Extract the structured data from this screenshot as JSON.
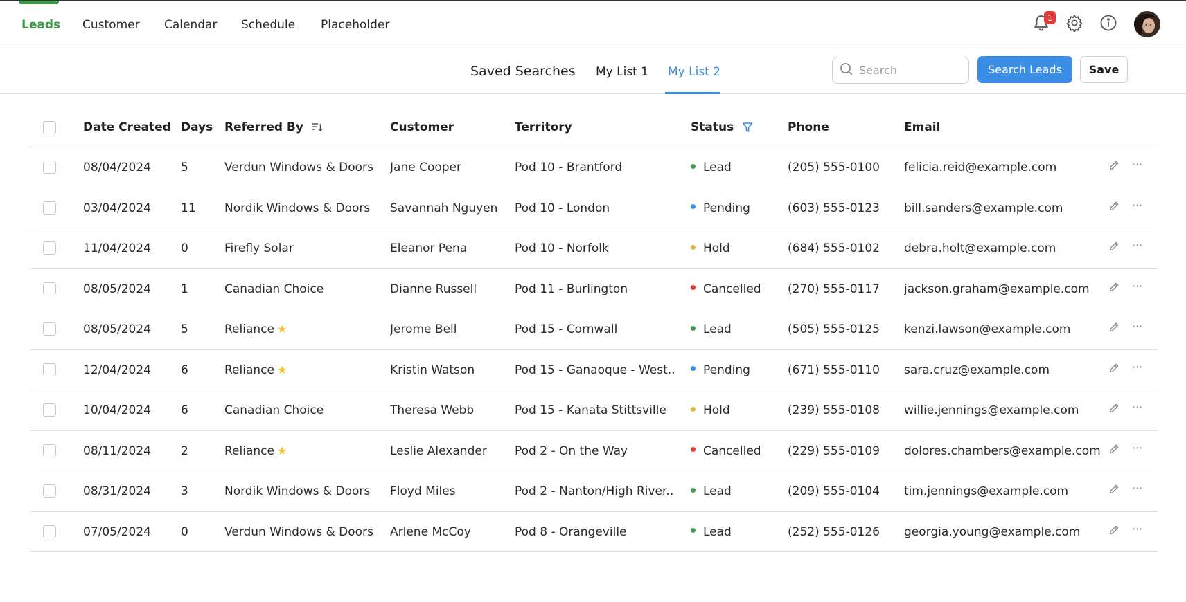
{
  "nav": {
    "items": [
      "Leads",
      "Customer",
      "Calendar",
      "Schedule",
      "Placeholder"
    ],
    "notification_count": "1",
    "accent_color": "#3f9a4b"
  },
  "subheader": {
    "title": "Saved Searches",
    "tabs": [
      "My List 1",
      "My List 2"
    ],
    "active_tab": "My List 2",
    "search_placeholder": "Search",
    "search_button": "Search Leads",
    "save_button": "Save",
    "primary_color": "#3b8ee5"
  },
  "table": {
    "headers": {
      "date": "Date Created",
      "days": "Days",
      "referred": "Referred By",
      "customer": "Customer",
      "territory": "Territory",
      "status": "Status",
      "phone": "Phone",
      "email": "Email"
    },
    "status_colors": {
      "Lead": "#3f9a4b",
      "Pending": "#3b8ee5",
      "Hold": "#e0b43a",
      "Cancelled": "#e53935"
    },
    "rows": [
      {
        "date": "08/04/2024",
        "days": "5",
        "referred": "Verdun Windows & Doors",
        "star": false,
        "customer": "Jane Cooper",
        "territory": "Pod 10 - Brantford",
        "status": "Lead",
        "phone": "(205) 555-0100",
        "email": "felicia.reid@example.com"
      },
      {
        "date": "03/04/2024",
        "days": "11",
        "referred": "Nordik Windows & Doors",
        "star": false,
        "customer": "Savannah Nguyen",
        "territory": "Pod 10 - London",
        "status": "Pending",
        "phone": "(603) 555-0123",
        "email": "bill.sanders@example.com"
      },
      {
        "date": "11/04/2024",
        "days": "0",
        "referred": "Firefly Solar",
        "star": false,
        "customer": "Eleanor Pena",
        "territory": "Pod 10 - Norfolk",
        "status": "Hold",
        "phone": "(684) 555-0102",
        "email": "debra.holt@example.com"
      },
      {
        "date": "08/05/2024",
        "days": "1",
        "referred": "Canadian Choice",
        "star": false,
        "customer": "Dianne Russell",
        "territory": "Pod 11 - Burlington",
        "status": "Cancelled",
        "phone": "(270) 555-0117",
        "email": "jackson.graham@example.com"
      },
      {
        "date": "08/05/2024",
        "days": "5",
        "referred": "Reliance",
        "star": true,
        "customer": "Jerome Bell",
        "territory": "Pod 15 - Cornwall",
        "status": "Lead",
        "phone": "(505) 555-0125",
        "email": "kenzi.lawson@example.com"
      },
      {
        "date": "12/04/2024",
        "days": "6",
        "referred": "Reliance",
        "star": true,
        "customer": "Kristin Watson",
        "territory": "Pod 15 - Ganaoque - West..",
        "status": "Pending",
        "phone": "(671) 555-0110",
        "email": "sara.cruz@example.com"
      },
      {
        "date": "10/04/2024",
        "days": "6",
        "referred": "Canadian Choice",
        "star": false,
        "customer": "Theresa Webb",
        "territory": "Pod 15 - Kanata Stittsville",
        "status": "Hold",
        "phone": "(239) 555-0108",
        "email": "willie.jennings@example.com"
      },
      {
        "date": "08/11/2024",
        "days": "2",
        "referred": "Reliance",
        "star": true,
        "customer": "Leslie Alexander",
        "territory": "Pod 2 - On the Way",
        "status": "Cancelled",
        "phone": "(229) 555-0109",
        "email": "dolores.chambers@example.com"
      },
      {
        "date": "08/31/2024",
        "days": "3",
        "referred": "Nordik Windows & Doors",
        "star": false,
        "customer": "Floyd Miles",
        "territory": "Pod 2 - Nanton/High River..",
        "status": "Lead",
        "phone": "(209) 555-0104",
        "email": "tim.jennings@example.com"
      },
      {
        "date": "07/05/2024",
        "days": "0",
        "referred": "Verdun Windows & Doors",
        "star": false,
        "customer": "Arlene McCoy",
        "territory": "Pod 8 - Orangeville",
        "status": "Lead",
        "phone": "(252) 555-0126",
        "email": "georgia.young@example.com"
      }
    ]
  }
}
